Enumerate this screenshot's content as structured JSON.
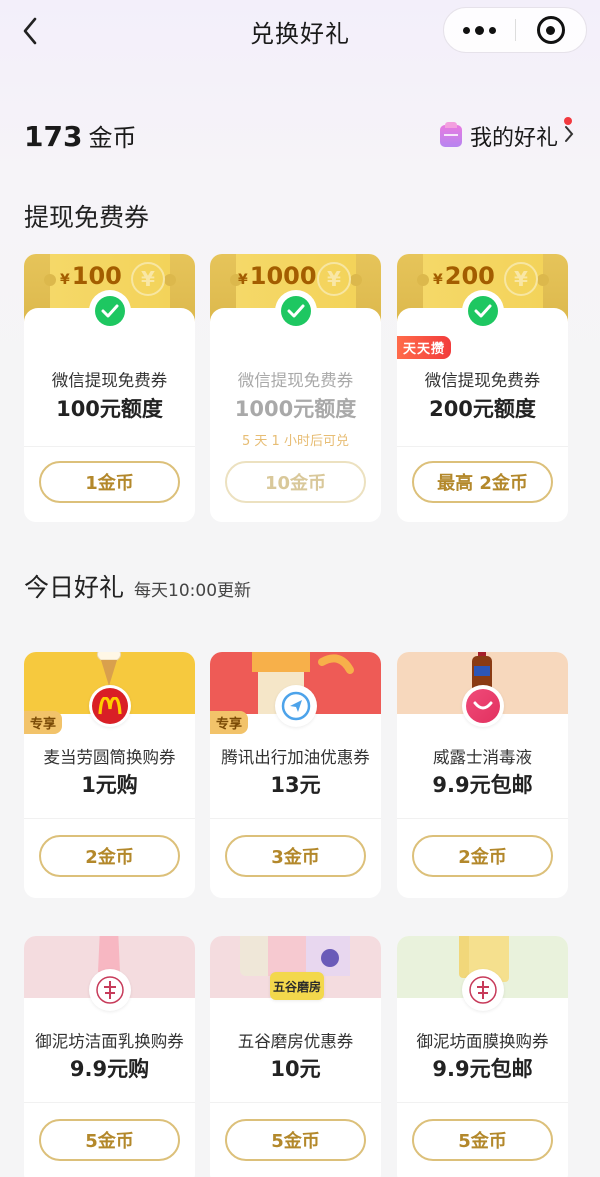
{
  "nav": {
    "title": "兑换好礼"
  },
  "header": {
    "coins_value": "173",
    "coins_unit": "金币",
    "my_gifts_label": "我的好礼"
  },
  "sections": {
    "withdraw_title": "提现免费券",
    "today_title": "今日好礼",
    "today_subtitle": "每天10:00更新"
  },
  "vouchers": [
    {
      "amount_prefix": "¥",
      "amount": "100",
      "name": "微信提现免费券",
      "value": "100元额度",
      "note": "",
      "button": "1金币",
      "tag": ""
    },
    {
      "amount_prefix": "¥",
      "amount": "1000",
      "name": "微信提现免费券",
      "value": "1000元额度",
      "note": "5 天 1 小时后可兑",
      "button": "10金币",
      "tag": ""
    },
    {
      "amount_prefix": "¥",
      "amount": "200",
      "name": "微信提现免费券",
      "value": "200元额度",
      "note": "",
      "button": "最高 2金币",
      "tag": "天天攒"
    }
  ],
  "gifts": [
    {
      "name": "麦当劳圆筒换购券",
      "value": "1元购",
      "button": "2金币",
      "tag": "专享",
      "logo": "mcdonalds-logo",
      "bg": "#f6c93e"
    },
    {
      "name": "腾讯出行加油优惠券",
      "value": "13元",
      "button": "3金币",
      "tag": "专享",
      "logo": "tencent-mobility-logo",
      "bg": "#ee5b56"
    },
    {
      "name": "威露士消毒液",
      "value": "9.9元包邮",
      "button": "2金币",
      "tag": "",
      "logo": "walch-logo",
      "bg": "#f7d8bd"
    },
    {
      "name": "御泥坊洁面乳换购券",
      "value": "9.9元购",
      "button": "5金币",
      "tag": "",
      "logo": "yunifang-logo",
      "bg": "#f4dcdf"
    },
    {
      "name": "五谷磨房优惠券",
      "value": "10元",
      "button": "5金币",
      "tag": "",
      "logo": "wugumofang-logo",
      "bg": "#f4dcdf",
      "logo_text": "五谷磨房"
    },
    {
      "name": "御泥坊面膜换购券",
      "value": "9.9元包邮",
      "button": "5金币",
      "tag": "",
      "logo": "yunifang-logo",
      "bg": "#e9f2dc"
    }
  ],
  "colors": {
    "accent_gold": "#dcc07a",
    "button_text": "#b3882b",
    "wechat_green": "#1ec761",
    "badge_red": "#f2393f"
  }
}
